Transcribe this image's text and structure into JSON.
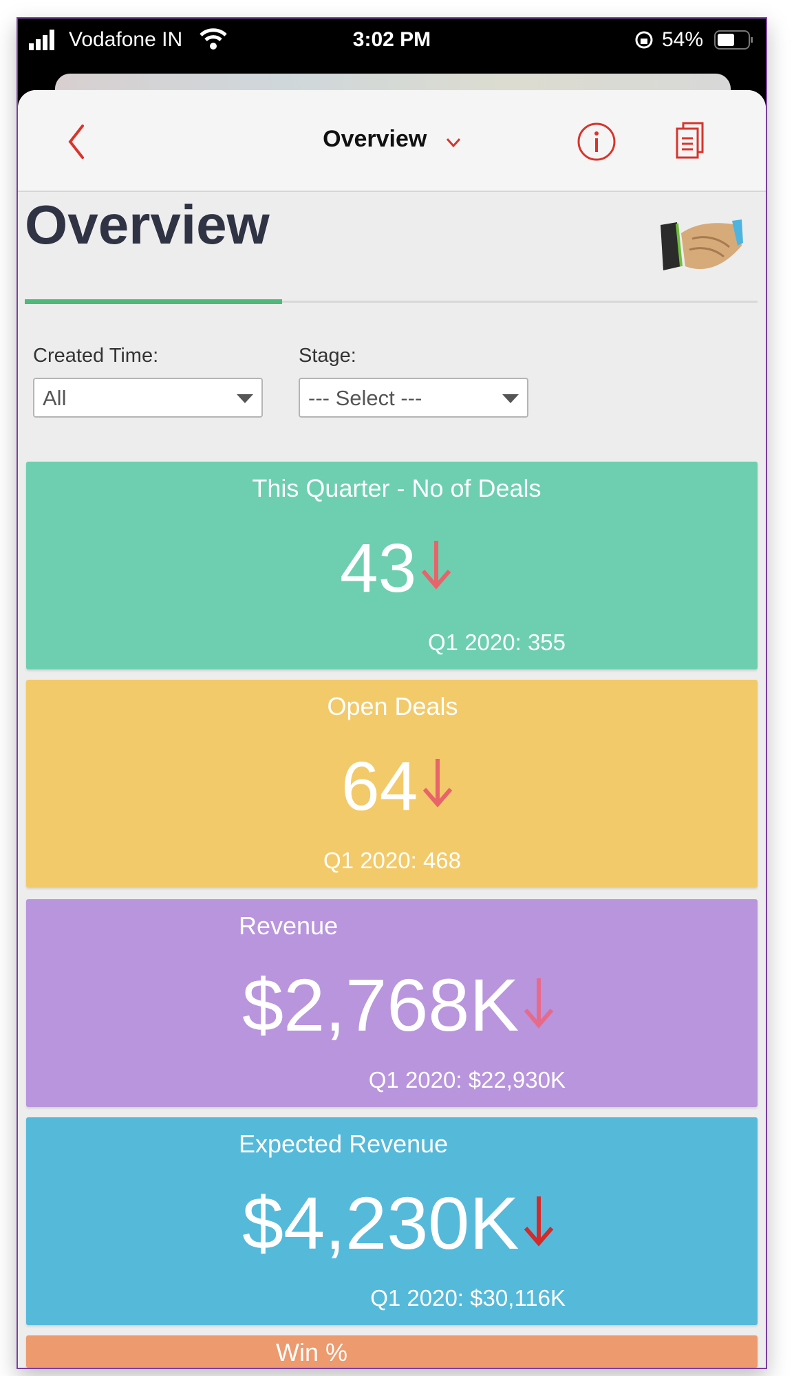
{
  "status_bar": {
    "carrier": "Vodafone IN",
    "time": "3:02 PM",
    "battery": "54%"
  },
  "nav": {
    "title": "Overview"
  },
  "page": {
    "heading": "Overview"
  },
  "filters": [
    {
      "label": "Created Time:",
      "value": "All"
    },
    {
      "label": "Stage:",
      "value": "--- Select ---"
    }
  ],
  "cards": [
    {
      "title": "This Quarter - No of Deals",
      "value": "43",
      "trend": "down",
      "compare": "Q1 2020: 355",
      "color": "#6dcfb0"
    },
    {
      "title": "Open Deals",
      "value": "64",
      "trend": "down",
      "compare": "Q1 2020: 468",
      "color": "#f3ca6a"
    },
    {
      "title": "Revenue",
      "value": "$2,768K",
      "trend": "down",
      "compare": "Q1 2020: $22,930K",
      "color": "#b895dd"
    },
    {
      "title": "Expected Revenue",
      "value": "$4,230K",
      "trend": "down",
      "compare": "Q1 2020: $30,116K",
      "color": "#55b9da"
    },
    {
      "title": "Win %",
      "color": "#ec9a6e"
    }
  ],
  "colors": {
    "accent": "#d9342b",
    "underline": "#4fb97a",
    "heading": "#2f3344"
  }
}
